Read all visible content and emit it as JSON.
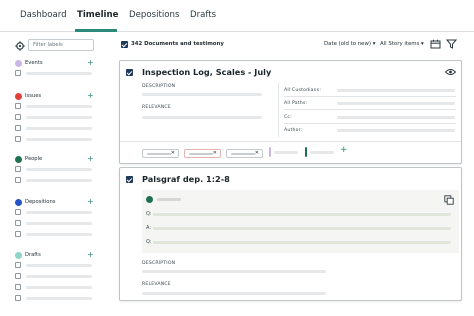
{
  "nav": {
    "tabs": [
      {
        "label": "Dashboard"
      },
      {
        "label": "Timeline"
      },
      {
        "label": "Depositions"
      },
      {
        "label": "Drafts"
      }
    ],
    "active_tab": "Timeline"
  },
  "sidebar": {
    "filter_placeholder": "Filter labels",
    "categories": [
      {
        "label": "Events",
        "color": "#c9b6e4"
      },
      {
        "label": "Issues",
        "color": "#e0413b"
      },
      {
        "label": "People",
        "color": "#1f6f52"
      },
      {
        "label": "Depositions",
        "color": "#2453c8"
      },
      {
        "label": "Drafts",
        "color": "#8fd3c9"
      }
    ]
  },
  "toolbar": {
    "count_label": "342 Documents and testimony",
    "sort_label": "Date (old to new)",
    "items_label": "All Story items"
  },
  "card1": {
    "title": "Inspection Log, Scales - July",
    "description_label": "DESCRIPTION",
    "relevance_label": "RELEVANCE",
    "meta_labels": [
      "All Custodians:",
      "All Paths:",
      "Cc:",
      "Author:"
    ],
    "chip_colors": [
      "#c4cacd",
      "#e7b3b1",
      "#c4cacd"
    ],
    "marker_colors": [
      "#c9b6e4",
      "#1f6f52"
    ]
  },
  "card2": {
    "title": "Palsgraf dep. 1:2-8",
    "qa_labels": [
      "Q:",
      "A:",
      "Q:"
    ],
    "description_label": "DESCRIPTION",
    "relevance_label": "RELEVANCE"
  },
  "colors": {
    "accent": "#2c8a78",
    "check": "#1f3a5a"
  }
}
